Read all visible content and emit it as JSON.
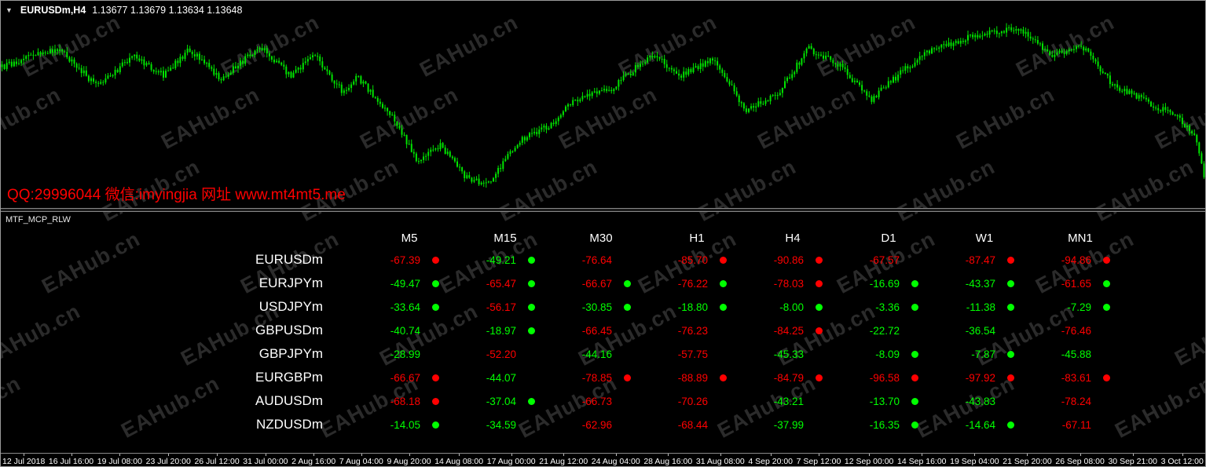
{
  "window_title": {
    "dropdown_icon": "chevron-down",
    "symbol_timeframe": "EURUSDm,H4",
    "quotes": "1.13677 1.13679 1.13634 1.13648"
  },
  "ticker_text": "QQ:29996044 微信:imyingjia 网址 www.mt4mt5.me",
  "watermark_text": "EAHub.cn",
  "indicator_panel": {
    "name": "MTF_MCP_RLW",
    "columns": [
      "M5",
      "M15",
      "M30",
      "H1",
      "H4",
      "D1",
      "W1",
      "MN1"
    ],
    "rows": [
      {
        "symbol": "EURUSDm",
        "cells": [
          {
            "value": "-67.39",
            "color": "red",
            "dot": "red"
          },
          {
            "value": "-49.21",
            "color": "green",
            "dot": "green"
          },
          {
            "value": "-76.64",
            "color": "red",
            "dot": "none"
          },
          {
            "value": "-85.70",
            "color": "red",
            "dot": "red"
          },
          {
            "value": "-90.86",
            "color": "red",
            "dot": "red"
          },
          {
            "value": "-67.57",
            "color": "red",
            "dot": "none"
          },
          {
            "value": "-87.47",
            "color": "red",
            "dot": "red"
          },
          {
            "value": "-94.86",
            "color": "red",
            "dot": "red"
          }
        ]
      },
      {
        "symbol": "EURJPYm",
        "cells": [
          {
            "value": "-49.47",
            "color": "green",
            "dot": "green"
          },
          {
            "value": "-65.47",
            "color": "red",
            "dot": "green"
          },
          {
            "value": "-66.67",
            "color": "red",
            "dot": "green"
          },
          {
            "value": "-76.22",
            "color": "red",
            "dot": "green"
          },
          {
            "value": "-78.03",
            "color": "red",
            "dot": "red"
          },
          {
            "value": "-16.69",
            "color": "green",
            "dot": "green"
          },
          {
            "value": "-43.37",
            "color": "green",
            "dot": "green"
          },
          {
            "value": "-61.65",
            "color": "red",
            "dot": "green"
          }
        ]
      },
      {
        "symbol": "USDJPYm",
        "cells": [
          {
            "value": "-33.64",
            "color": "green",
            "dot": "green"
          },
          {
            "value": "-56.17",
            "color": "red",
            "dot": "green"
          },
          {
            "value": "-30.85",
            "color": "green",
            "dot": "green"
          },
          {
            "value": "-18.80",
            "color": "green",
            "dot": "green"
          },
          {
            "value": "-8.00",
            "color": "green",
            "dot": "green"
          },
          {
            "value": "-3.36",
            "color": "green",
            "dot": "green"
          },
          {
            "value": "-11.38",
            "color": "green",
            "dot": "green"
          },
          {
            "value": "-7.29",
            "color": "green",
            "dot": "green"
          }
        ]
      },
      {
        "symbol": "GBPUSDm",
        "cells": [
          {
            "value": "-40.74",
            "color": "green",
            "dot": "none"
          },
          {
            "value": "-18.97",
            "color": "green",
            "dot": "green"
          },
          {
            "value": "-66.45",
            "color": "red",
            "dot": "none"
          },
          {
            "value": "-76.23",
            "color": "red",
            "dot": "none"
          },
          {
            "value": "-84.25",
            "color": "red",
            "dot": "red"
          },
          {
            "value": "-22.72",
            "color": "green",
            "dot": "none"
          },
          {
            "value": "-36.54",
            "color": "green",
            "dot": "none"
          },
          {
            "value": "-76.46",
            "color": "red",
            "dot": "none"
          }
        ]
      },
      {
        "symbol": "GBPJPYm",
        "cells": [
          {
            "value": "-28.99",
            "color": "green",
            "dot": "none"
          },
          {
            "value": "-52.20",
            "color": "red",
            "dot": "none"
          },
          {
            "value": "-44.16",
            "color": "green",
            "dot": "none"
          },
          {
            "value": "-57.75",
            "color": "red",
            "dot": "none"
          },
          {
            "value": "-45.33",
            "color": "green",
            "dot": "none"
          },
          {
            "value": "-8.09",
            "color": "green",
            "dot": "green"
          },
          {
            "value": "-7.87",
            "color": "green",
            "dot": "green"
          },
          {
            "value": "-45.88",
            "color": "green",
            "dot": "none"
          }
        ]
      },
      {
        "symbol": "EURGBPm",
        "cells": [
          {
            "value": "-66.67",
            "color": "red",
            "dot": "red"
          },
          {
            "value": "-44.07",
            "color": "green",
            "dot": "none"
          },
          {
            "value": "-78.85",
            "color": "red",
            "dot": "red"
          },
          {
            "value": "-88.89",
            "color": "red",
            "dot": "red"
          },
          {
            "value": "-84.79",
            "color": "red",
            "dot": "red"
          },
          {
            "value": "-96.58",
            "color": "red",
            "dot": "red"
          },
          {
            "value": "-97.92",
            "color": "red",
            "dot": "red"
          },
          {
            "value": "-83.61",
            "color": "red",
            "dot": "red"
          }
        ]
      },
      {
        "symbol": "AUDUSDm",
        "cells": [
          {
            "value": "-68.18",
            "color": "red",
            "dot": "red"
          },
          {
            "value": "-37.04",
            "color": "green",
            "dot": "green"
          },
          {
            "value": "-66.73",
            "color": "red",
            "dot": "none"
          },
          {
            "value": "-70.26",
            "color": "red",
            "dot": "none"
          },
          {
            "value": "-43.21",
            "color": "green",
            "dot": "none"
          },
          {
            "value": "-13.70",
            "color": "green",
            "dot": "green"
          },
          {
            "value": "-43.83",
            "color": "green",
            "dot": "none"
          },
          {
            "value": "-78.24",
            "color": "red",
            "dot": "none"
          }
        ]
      },
      {
        "symbol": "NZDUSDm",
        "cells": [
          {
            "value": "-14.05",
            "color": "green",
            "dot": "green"
          },
          {
            "value": "-34.59",
            "color": "green",
            "dot": "none"
          },
          {
            "value": "-62.96",
            "color": "red",
            "dot": "none"
          },
          {
            "value": "-68.44",
            "color": "red",
            "dot": "none"
          },
          {
            "value": "-37.99",
            "color": "green",
            "dot": "none"
          },
          {
            "value": "-16.35",
            "color": "green",
            "dot": "green"
          },
          {
            "value": "-14.64",
            "color": "green",
            "dot": "green"
          },
          {
            "value": "-67.11",
            "color": "red",
            "dot": "none"
          }
        ]
      }
    ]
  },
  "time_axis_labels": [
    "12 Jul 2018",
    "16 Jul 16:00",
    "19 Jul 08:00",
    "23 Jul 20:00",
    "26 Jul 12:00",
    "31 Jul 00:00",
    "2 Aug 16:00",
    "7 Aug 04:00",
    "9 Aug 20:00",
    "14 Aug 08:00",
    "17 Aug 00:00",
    "21 Aug 12:00",
    "24 Aug 04:00",
    "28 Aug 16:00",
    "31 Aug 08:00",
    "4 Sep 20:00",
    "7 Sep 12:00",
    "12 Sep 00:00",
    "14 Sep 16:00",
    "19 Sep 04:00",
    "21 Sep 20:00",
    "26 Sep 08:00",
    "30 Sep 21:00",
    "3 Oct 12:00"
  ],
  "chart_data": {
    "type": "candlestick",
    "symbol": "EURUSDm",
    "timeframe": "H4",
    "quote_open": "1.13677",
    "quote_high": "1.13679",
    "quote_low": "1.13634",
    "quote_close": "1.13648",
    "price_path_normalized": [
      [
        0.0,
        0.32
      ],
      [
        0.025,
        0.26
      ],
      [
        0.048,
        0.23
      ],
      [
        0.078,
        0.41
      ],
      [
        0.11,
        0.27
      ],
      [
        0.135,
        0.36
      ],
      [
        0.156,
        0.23
      ],
      [
        0.182,
        0.38
      ],
      [
        0.215,
        0.22
      ],
      [
        0.24,
        0.36
      ],
      [
        0.26,
        0.26
      ],
      [
        0.285,
        0.45
      ],
      [
        0.295,
        0.36
      ],
      [
        0.326,
        0.57
      ],
      [
        0.345,
        0.77
      ],
      [
        0.365,
        0.7
      ],
      [
        0.385,
        0.85
      ],
      [
        0.404,
        0.89
      ],
      [
        0.43,
        0.68
      ],
      [
        0.456,
        0.6
      ],
      [
        0.475,
        0.49
      ],
      [
        0.508,
        0.42
      ],
      [
        0.54,
        0.26
      ],
      [
        0.566,
        0.36
      ],
      [
        0.593,
        0.28
      ],
      [
        0.619,
        0.53
      ],
      [
        0.645,
        0.45
      ],
      [
        0.671,
        0.23
      ],
      [
        0.697,
        0.31
      ],
      [
        0.723,
        0.48
      ],
      [
        0.749,
        0.34
      ],
      [
        0.775,
        0.23
      ],
      [
        0.808,
        0.17
      ],
      [
        0.847,
        0.13
      ],
      [
        0.873,
        0.26
      ],
      [
        0.899,
        0.22
      ],
      [
        0.925,
        0.41
      ],
      [
        0.951,
        0.48
      ],
      [
        0.977,
        0.56
      ],
      [
        0.993,
        0.65
      ],
      [
        1.0,
        0.85
      ]
    ]
  },
  "colors": {
    "bullish": "#00ff00",
    "bearish": "#ff0000",
    "candle": "#00e400",
    "text": "#ffffff",
    "ticker": "#ff0000",
    "watermark": "#2b2b2b"
  }
}
